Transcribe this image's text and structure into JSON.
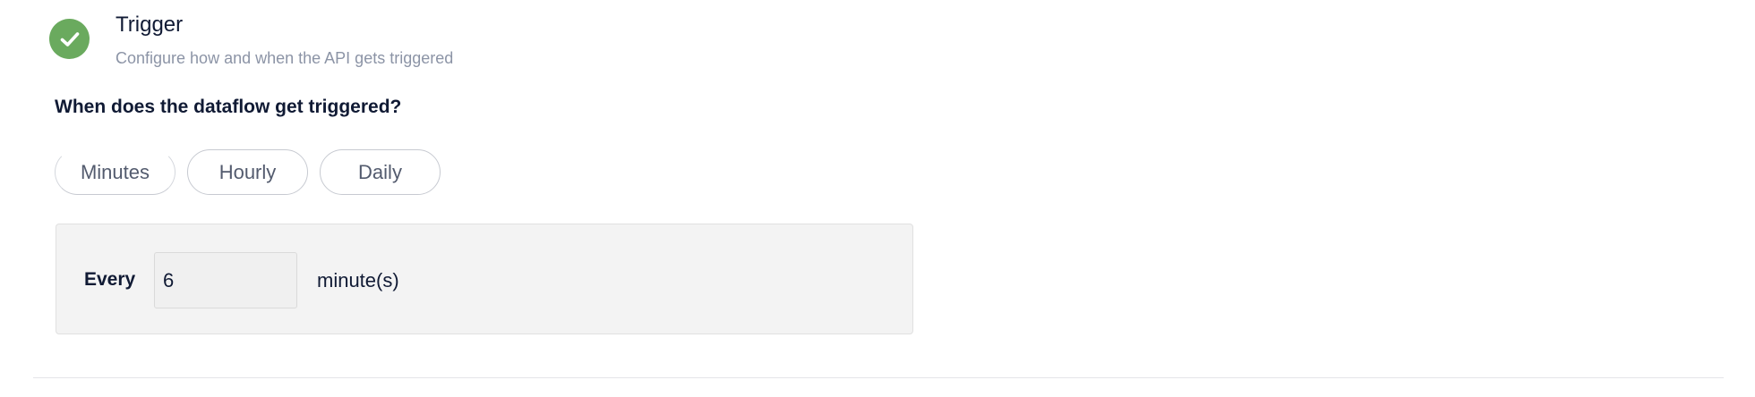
{
  "step": {
    "icon": "check-icon",
    "status_color": "#6aaa5e",
    "title": "Trigger",
    "subtitle": "Configure how and when the API gets triggered"
  },
  "frequency": {
    "question": "When does the dataflow get triggered?",
    "options": [
      {
        "label": "Minutes",
        "selected": true
      },
      {
        "label": "Hourly",
        "selected": false
      },
      {
        "label": "Daily",
        "selected": false
      }
    ]
  },
  "schedule": {
    "prefix_label": "Every",
    "interval_value": "6",
    "unit_label": "minute(s)"
  }
}
